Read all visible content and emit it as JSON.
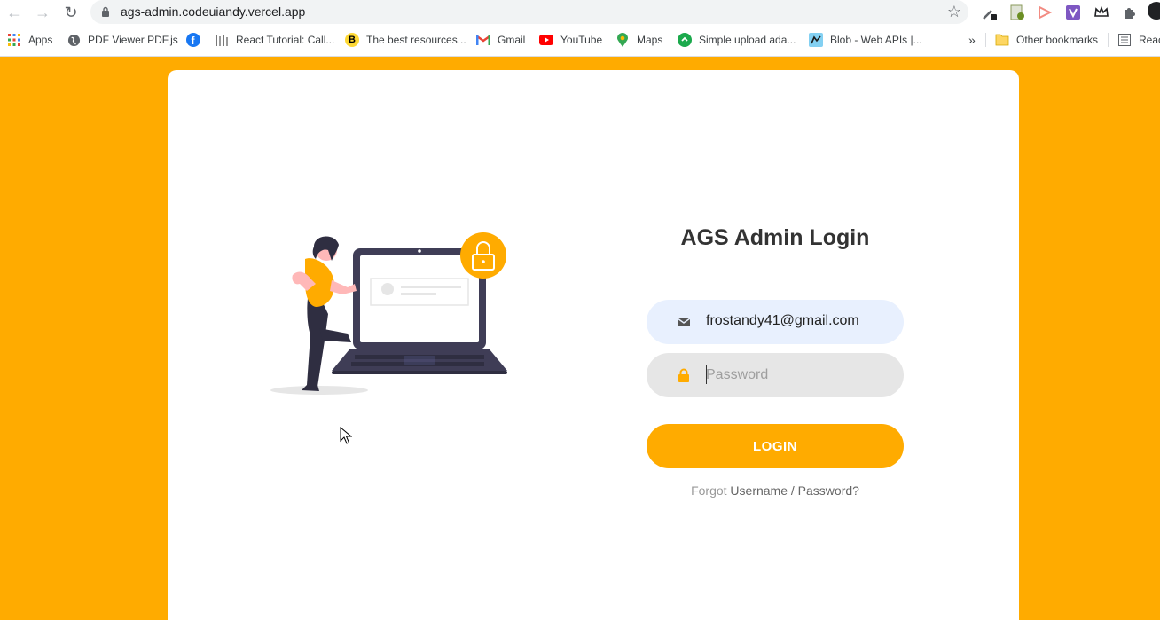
{
  "browser": {
    "url": "ags-admin.codeuiandy.vercel.app",
    "bookmarks": [
      {
        "label": "Apps",
        "icon": "apps-grid-icon"
      },
      {
        "label": "PDF Viewer PDF.js",
        "icon": "globe-icon"
      },
      {
        "label": "",
        "icon": "facebook-icon"
      },
      {
        "label": "React Tutorial: Call...",
        "icon": "react-tutorial-icon"
      },
      {
        "label": "The best resources...",
        "icon": "bookmark-b-icon"
      },
      {
        "label": "Gmail",
        "icon": "gmail-icon"
      },
      {
        "label": "YouTube",
        "icon": "youtube-icon"
      },
      {
        "label": "Maps",
        "icon": "maps-icon"
      },
      {
        "label": "Simple upload ada...",
        "icon": "simple-upload-icon"
      },
      {
        "label": "Blob - Web APIs |...",
        "icon": "mdn-icon"
      }
    ],
    "more_bookmarks": "»",
    "other_bookmarks": "Other bookmarks",
    "reading_list": "Reac"
  },
  "login": {
    "title": "AGS Admin Login",
    "email_value": "frostandy41@gmail.com",
    "password_placeholder": "Password",
    "button_label": "LOGIN",
    "forgot_label": "Forgot",
    "forgot_link": "Username / Password?"
  },
  "colors": {
    "accent": "#ffab00",
    "email_field_bg": "#e8f0fe",
    "password_field_bg": "#e6e6e6"
  }
}
